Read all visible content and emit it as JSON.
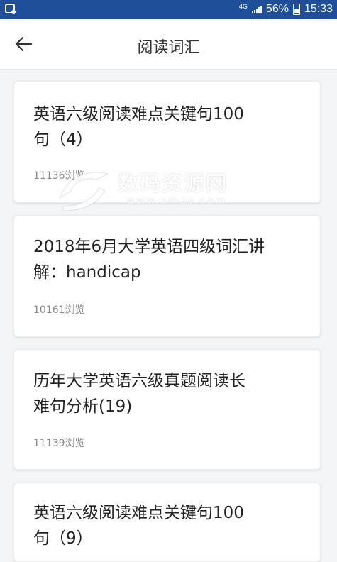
{
  "status_bar": {
    "network": "4G",
    "battery": "56%",
    "time": "15:33"
  },
  "header": {
    "title": "阅读词汇"
  },
  "cards": [
    {
      "title_line1": "英语六级阅读难点关键句100",
      "title_line2": "句（4）",
      "views": "11136浏览"
    },
    {
      "title_line1": "2018年6月大学英语四级词汇讲",
      "title_line2": "解：handicap",
      "views": "10161浏览"
    },
    {
      "title_line1": "历年大学英语六级真题阅读长",
      "title_line2": "难句分析(19)",
      "views": "11139浏览"
    },
    {
      "title_line1": "英语六级阅读难点关键句100",
      "title_line2": "句（9）"
    }
  ],
  "watermark": {
    "text": "数码资源网",
    "url": "www.smzy.com"
  },
  "colors": {
    "status_bar": "#1f4f99",
    "background": "#f4f5f7"
  }
}
